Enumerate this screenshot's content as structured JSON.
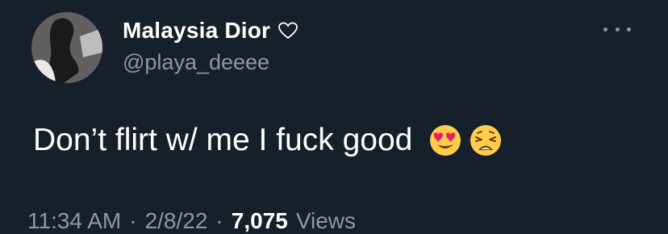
{
  "user": {
    "display_name": "Malaysia Dior",
    "handle": "@playa_deeee"
  },
  "icons": {
    "heart": "heart-outline-icon",
    "more": "more-dots-icon",
    "emoji_1": "heart-eyes-face-emoji",
    "emoji_2": "weary-face-emoji"
  },
  "tweet": {
    "text": "Don’t flirt w/ me I fuck good"
  },
  "meta": {
    "time": "11:34 AM",
    "separator": "·",
    "date": "2/8/22",
    "separator2": "·",
    "views_count": "7,075",
    "views_label": "Views"
  },
  "colors": {
    "background": "#15202b",
    "primary_text": "#ffffff",
    "secondary_text": "#8b98a5"
  }
}
